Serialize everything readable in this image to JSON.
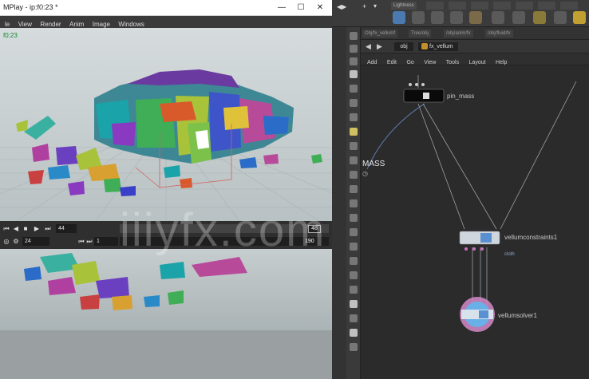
{
  "mplay": {
    "title": "MPlay - ip:f0:23 *",
    "window_controls": {
      "minimize": "—",
      "maximize": "☐",
      "close": "✕"
    },
    "menu": [
      "le",
      "View",
      "Render",
      "Anim",
      "Image",
      "Windows"
    ],
    "frame_readout": "f0:23",
    "timeline": {
      "current_frame": "44",
      "playhead_frame": "48",
      "start_frame": "24",
      "range_start": "1",
      "end_frame": "190"
    }
  },
  "houdini": {
    "shelf_tabs": [
      "Lightness",
      "",
      "",
      "",
      "",
      "",
      "",
      ""
    ],
    "breadcrumbs": [
      "Obj/fx_vellumf",
      "Tree/obj",
      "/obj/anim/fx",
      "/obj/fluid/fx"
    ],
    "path": {
      "context": "obj",
      "node": "fx_vellum"
    },
    "menu": [
      "Add",
      "Edit",
      "Go",
      "View",
      "Tools",
      "Layout",
      "Help"
    ],
    "mass_label": "MASS",
    "nodes": [
      {
        "label": "pin_mass",
        "sub": ""
      },
      {
        "label": "vellumconstraints1",
        "sub": "cloth"
      },
      {
        "label": "vellumsolver1",
        "sub": ""
      }
    ]
  },
  "watermark": "iiiyfx.com",
  "colors": {
    "viewport_bg": "#c9d0d2",
    "timeline_bg": "#2f2f2f",
    "network_bg": "#2b2b2b",
    "frame_readout": "#0d8a2a",
    "node_blue": "#8fa9c9"
  }
}
